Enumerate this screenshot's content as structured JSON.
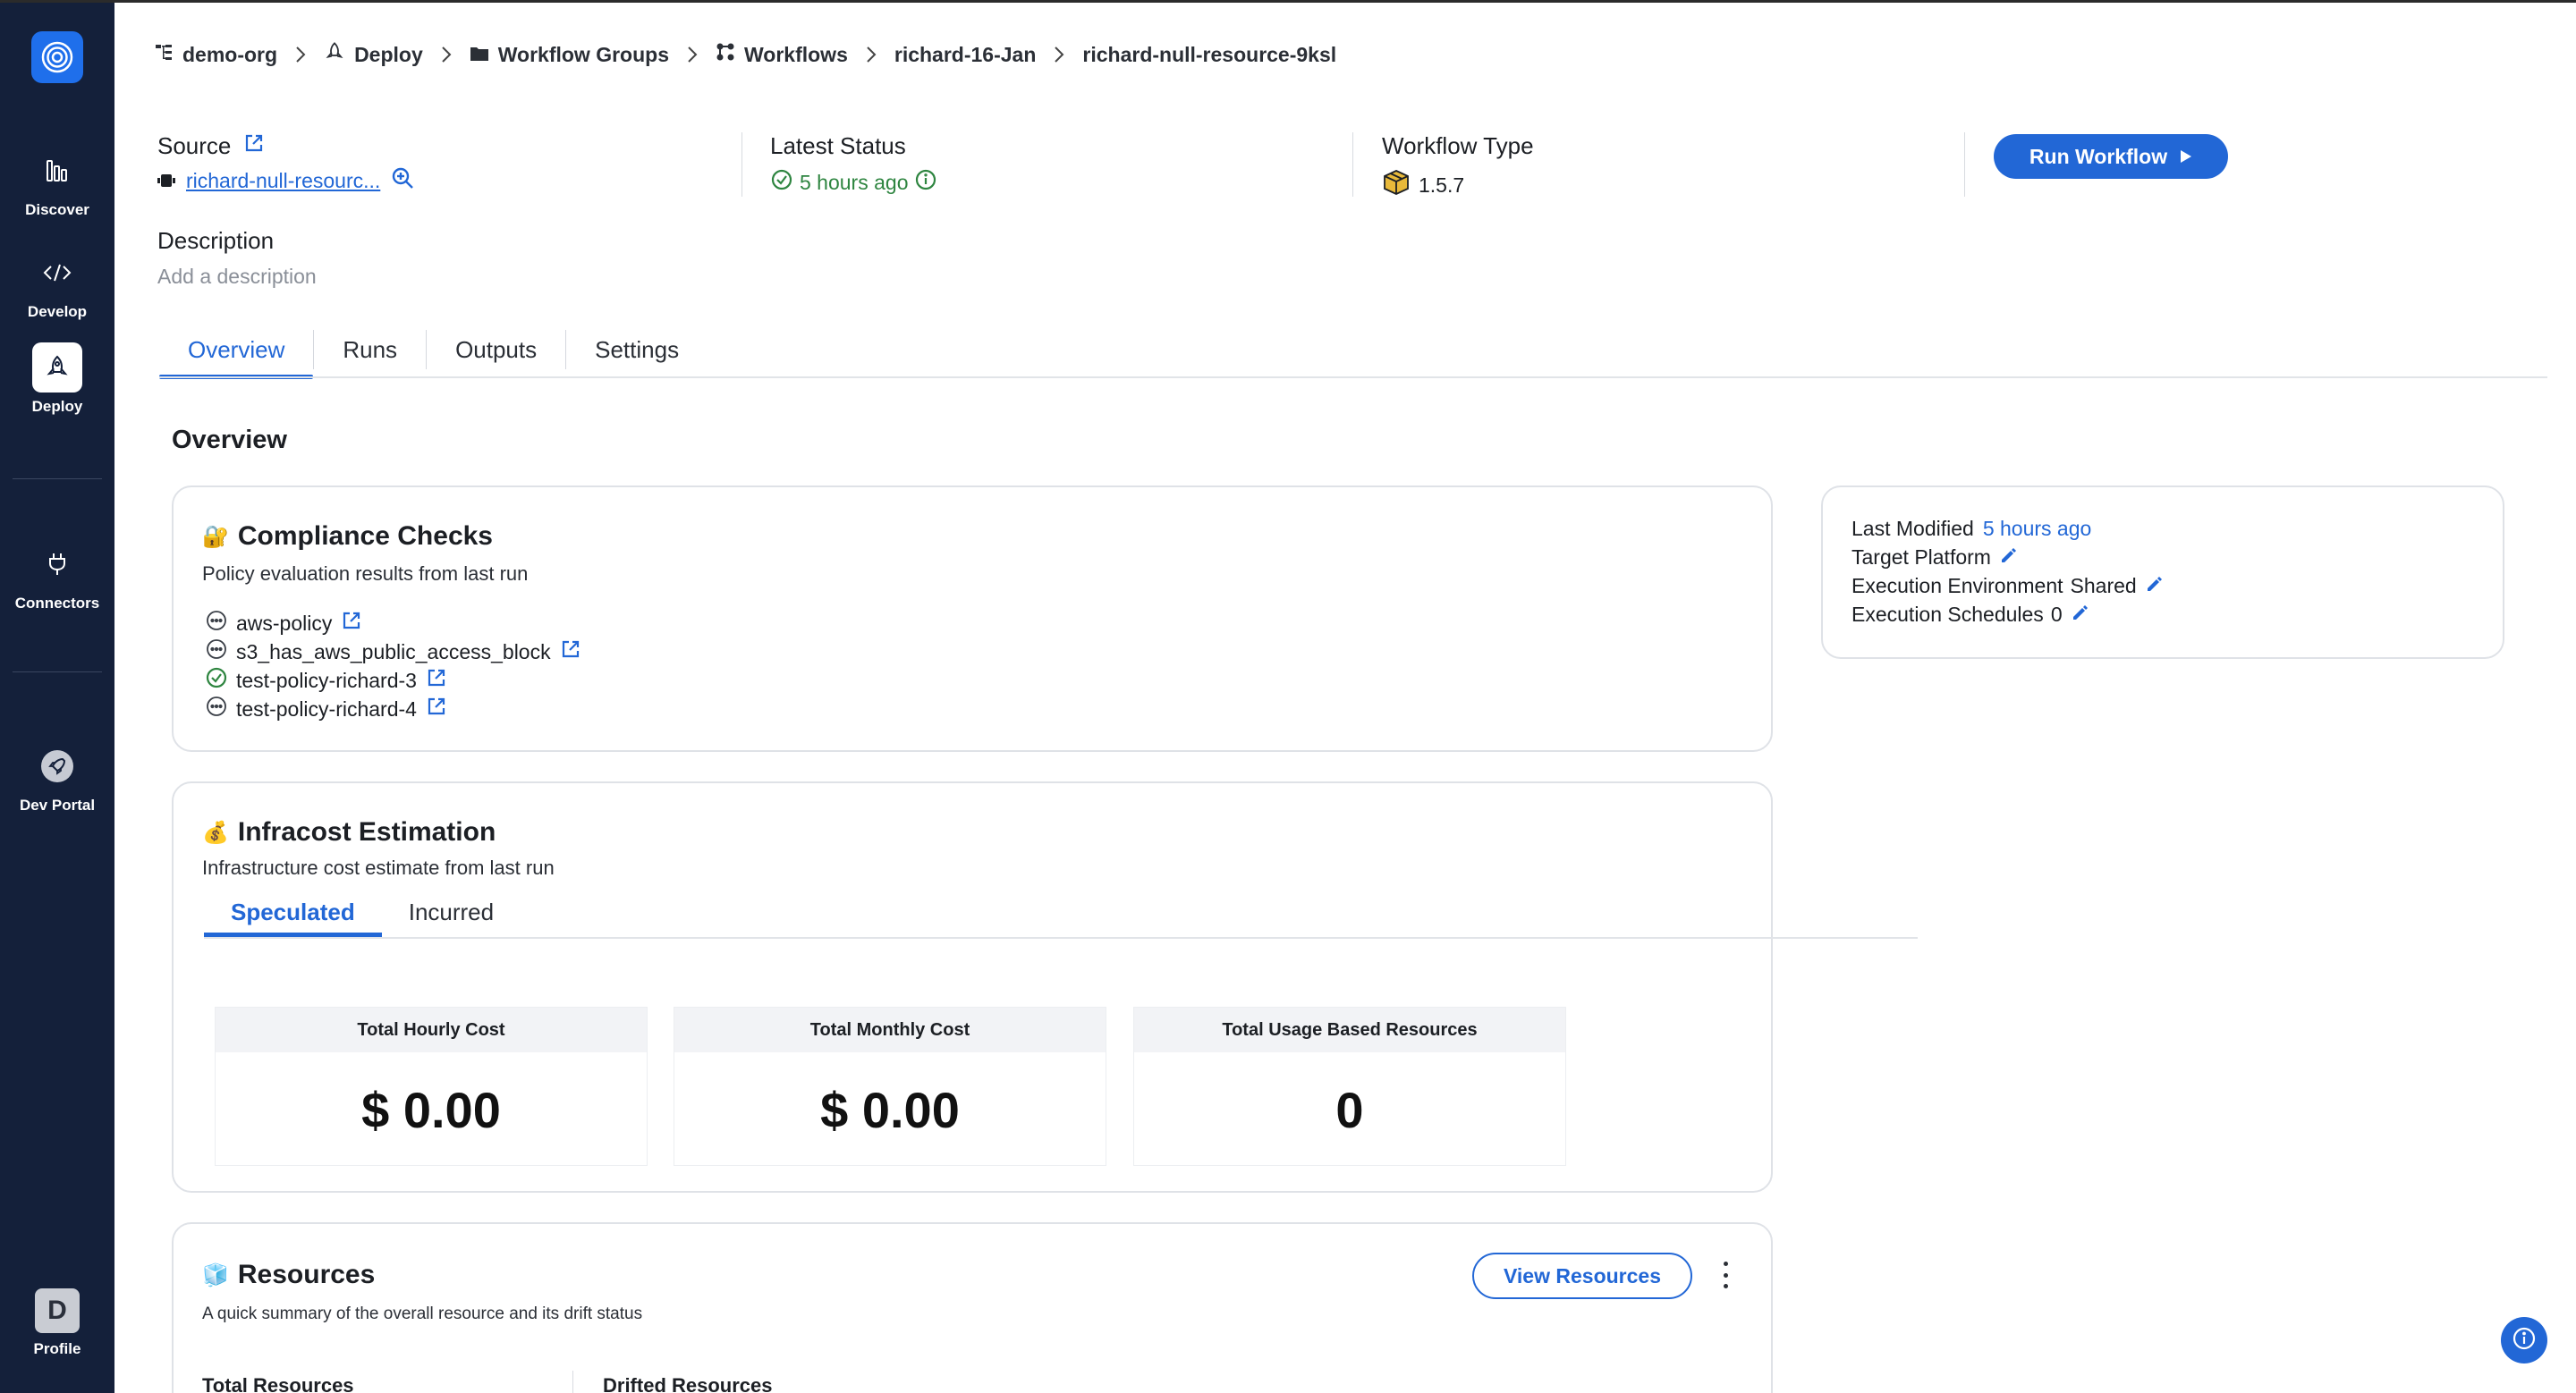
{
  "sidebar": {
    "items": [
      {
        "label": "Discover",
        "icon": "bar-chart-icon"
      },
      {
        "label": "Develop",
        "icon": "code-icon"
      },
      {
        "label": "Deploy",
        "icon": "deploy-icon",
        "active": true
      },
      {
        "label": "Connectors",
        "icon": "plug-icon"
      },
      {
        "label": "Dev Portal",
        "icon": "rocket-icon"
      }
    ],
    "profile": {
      "initial": "D",
      "label": "Profile"
    }
  },
  "breadcrumb": [
    {
      "label": "demo-org",
      "icon": "org-icon"
    },
    {
      "label": "Deploy",
      "icon": "deploy-icon"
    },
    {
      "label": "Workflow Groups",
      "icon": "folder-icon"
    },
    {
      "label": "Workflows",
      "icon": "workflows-icon"
    },
    {
      "label": "richard-16-Jan"
    },
    {
      "label": "richard-null-resource-9ksl"
    }
  ],
  "header": {
    "source_label": "Source",
    "source_value": "richard-null-resourc...",
    "latest_status_label": "Latest Status",
    "latest_status_value": "5 hours ago",
    "workflow_type_label": "Workflow Type",
    "workflow_type_value": "1.5.7",
    "run_button": "Run Workflow",
    "description_label": "Description",
    "description_placeholder": "Add a description"
  },
  "tabs": [
    "Overview",
    "Runs",
    "Outputs",
    "Settings"
  ],
  "active_tab": "Overview",
  "overview_title": "Overview",
  "compliance": {
    "emoji": "🔐",
    "title": "Compliance Checks",
    "subtitle": "Policy evaluation results from last run",
    "policies": [
      {
        "name": "aws-policy",
        "status": "unknown"
      },
      {
        "name": "s3_has_aws_public_access_block",
        "status": "unknown"
      },
      {
        "name": "test-policy-richard-3",
        "status": "passed"
      },
      {
        "name": "test-policy-richard-4",
        "status": "unknown"
      }
    ]
  },
  "meta": {
    "last_modified_label": "Last Modified",
    "last_modified_value": "5 hours ago",
    "target_platform_label": "Target Platform",
    "exec_env_label": "Execution Environment",
    "exec_env_value": "Shared",
    "exec_sched_label": "Execution Schedules",
    "exec_sched_value": "0"
  },
  "infracost": {
    "emoji": "💰",
    "title": "Infracost Estimation",
    "subtitle": "Infrastructure cost estimate from last run",
    "tabs": [
      "Speculated",
      "Incurred"
    ],
    "metrics": [
      {
        "label": "Total Hourly Cost",
        "value": "$ 0.00"
      },
      {
        "label": "Total Monthly Cost",
        "value": "$ 0.00"
      },
      {
        "label": "Total Usage Based Resources",
        "value": "0"
      }
    ]
  },
  "resources": {
    "emoji": "🧊",
    "title": "Resources",
    "subtitle": "A quick summary of the overall resource and its drift status",
    "view_button": "View Resources",
    "total_label": "Total Resources",
    "drifted_label": "Drifted Resources"
  },
  "colors": {
    "accent": "#2267d6",
    "sidebar": "#14203a",
    "success": "#2e8540"
  }
}
